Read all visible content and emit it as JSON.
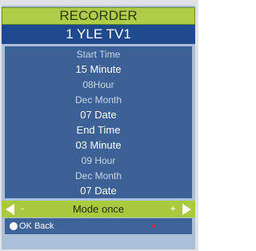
{
  "header": {
    "title": "RECORDER"
  },
  "channel": {
    "label": "1 YLE TV1"
  },
  "rows": [
    {
      "text": "Start Time",
      "bright": false
    },
    {
      "text": "15 Minute",
      "bright": true
    },
    {
      "text": "08Hour",
      "bright": false
    },
    {
      "text": "Dec Month",
      "bright": false
    },
    {
      "text": "07 Date",
      "bright": true
    },
    {
      "text": "End Time",
      "bright": true
    },
    {
      "text": "03 Minute",
      "bright": true
    },
    {
      "text": "09 Hour",
      "bright": false
    },
    {
      "text": "Dec Month",
      "bright": false
    },
    {
      "text": "07 Date",
      "bright": true
    }
  ],
  "mode": {
    "label": "Mode once",
    "minus": "-",
    "plus": "+"
  },
  "footer": {
    "label": "OK Back"
  },
  "colors": {
    "accent_green": "#b1cc48",
    "row_blue": "#3b6197",
    "indicator_red": "#e32a3c"
  }
}
